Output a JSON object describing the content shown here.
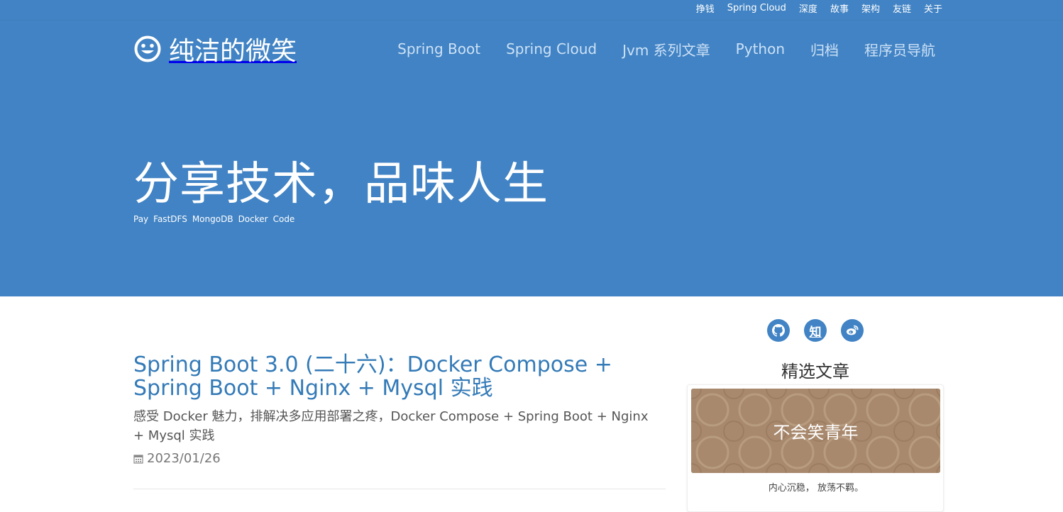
{
  "topbar": {
    "links": [
      "挣钱",
      "Spring Cloud",
      "深度",
      "故事",
      "架构",
      "友链",
      "关于"
    ]
  },
  "brand": {
    "icon": "smiley-icon",
    "name": "纯洁的微笑"
  },
  "nav": {
    "items": [
      "Spring Boot",
      "Spring Cloud",
      "Jvm 系列文章",
      "Python",
      "归档",
      "程序员导航"
    ]
  },
  "hero": {
    "title": "分享技术，品味人生",
    "tags": [
      "Pay",
      "FastDFS",
      "MongoDB",
      "Docker",
      "Code"
    ]
  },
  "post": {
    "title": "Spring Boot 3.0 (二十六)：Docker Compose + Spring Boot + Nginx + Mysql 实践",
    "summary": "感受 Docker 魅力，排解决多应用部署之疼，Docker Compose + Spring Boot + Nginx + Mysql 实践",
    "date_icon": "calendar-icon",
    "date": "2023/01/26"
  },
  "sidebar": {
    "social": [
      {
        "icon": "github-icon",
        "label": ""
      },
      {
        "icon": "zhihu-icon",
        "label": "知"
      },
      {
        "icon": "weibo-icon",
        "label": ""
      }
    ],
    "featured_title": "精选文章",
    "featured": {
      "title": "不会笑青年",
      "description": "内心沉稳， 放荡不羁。"
    }
  },
  "colors": {
    "primary": "#4183c4",
    "link": "#337ab7",
    "nav_link": "#cde1f6",
    "banner": "#a8896d"
  }
}
